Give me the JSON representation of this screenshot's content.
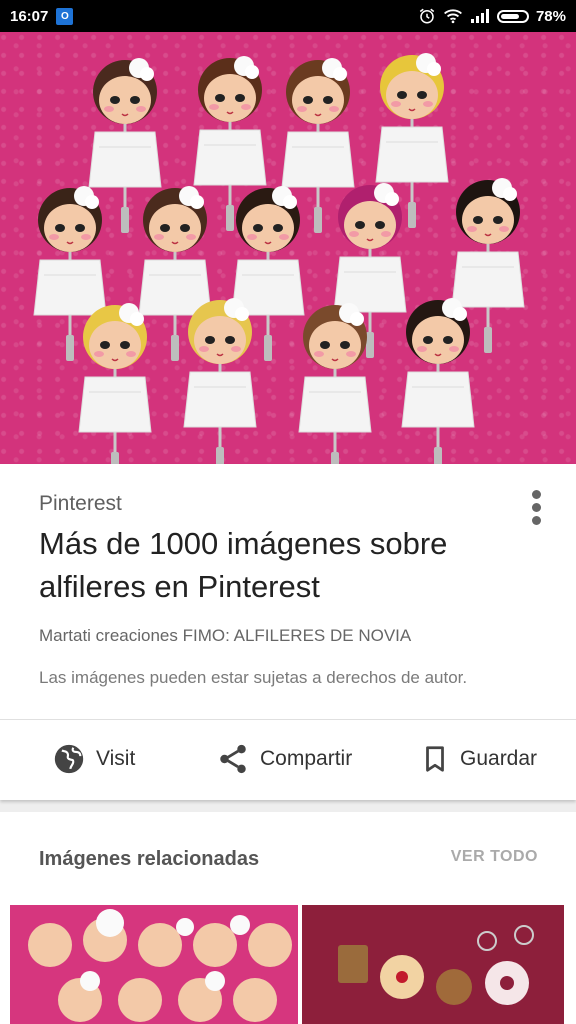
{
  "status_bar": {
    "time": "16:07",
    "battery": "78%",
    "battery_level": 0.78,
    "icons": [
      "outlook-icon",
      "alarm-icon",
      "wifi-icon",
      "signal-icon",
      "battery-icon"
    ]
  },
  "hero": {
    "background_color": "#d3337c"
  },
  "card": {
    "source": "Pinterest",
    "title": "Más de 1000 imágenes sobre alfileres en Pinterest",
    "caption": "Martati creaciones FIMO: ALFILERES DE NOVIA",
    "copyright": "Las imágenes pueden estar sujetas a derechos de autor.",
    "actions": {
      "visit": "Visit",
      "share": "Compartir",
      "save": "Guardar"
    }
  },
  "related": {
    "title": "Imágenes relacionadas",
    "view_all": "VER TODO"
  },
  "colors": {
    "brand_pink": "#d3337c",
    "text_dark": "#222222",
    "icon_gray": "#444444"
  }
}
